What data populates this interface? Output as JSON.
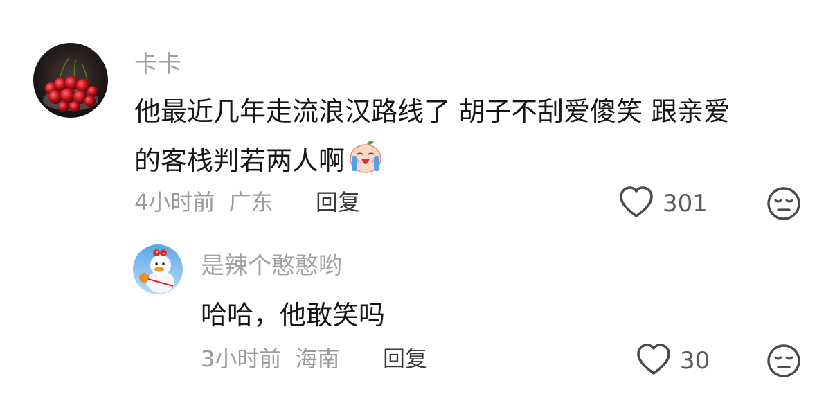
{
  "comments": [
    {
      "username": "卡卡",
      "text_line1": "他最近几年走流浪汉路线了 胡子不刮爱傻笑 跟亲爱",
      "text_line2": "的客栈判若两人啊",
      "emoji": "crying-face-emoji",
      "time": "4小时前",
      "location": "广东",
      "reply_label": "回复",
      "likes": "301",
      "avatar_icon": "cherries-avatar"
    },
    {
      "username": "是辣个憨憨哟",
      "text_line1": "哈哈，他敢笑吗",
      "time": "3小时前",
      "location": "海南",
      "reply_label": "回复",
      "likes": "30",
      "avatar_icon": "duck-avatar"
    }
  ],
  "icons": {
    "like": "heart-icon",
    "dislike": "unamused-face-icon"
  },
  "colors": {
    "username": "#a3a3a3",
    "text": "#161616",
    "meta": "#9b9b9b",
    "icon": "#4a4a4a"
  }
}
